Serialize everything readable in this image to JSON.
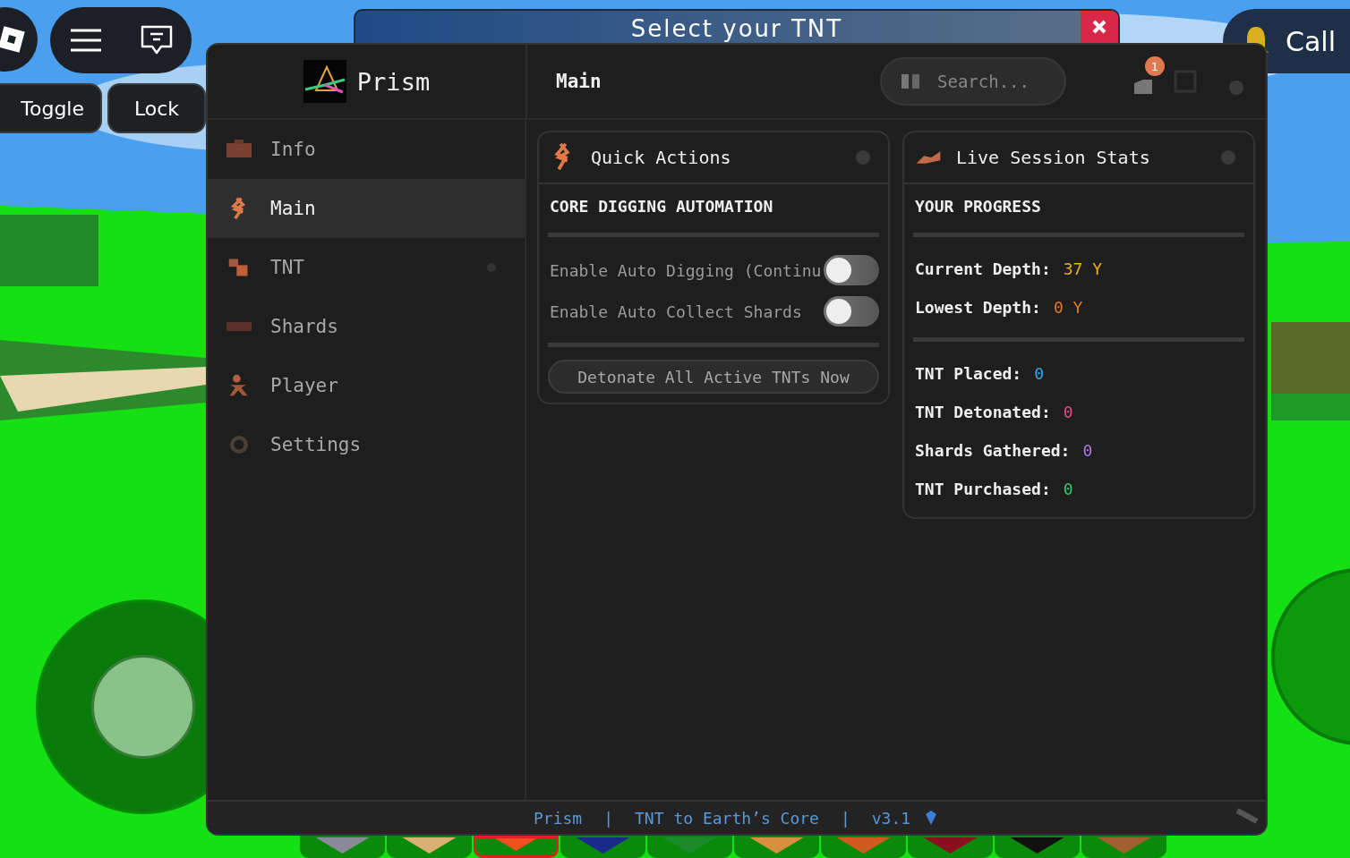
{
  "hud": {
    "toggle_button": "Toggle",
    "lock_button": "Lock",
    "banner_title": "Select your TNT",
    "call_button": "Call"
  },
  "hotbar": [
    {
      "color": "#8a8a9a",
      "selected": false
    },
    {
      "color": "#d8b070",
      "selected": false
    },
    {
      "color": "#f05020",
      "selected": true
    },
    {
      "color": "#1a2a8a",
      "selected": false
    },
    {
      "color": "#1a8a2a",
      "selected": false
    },
    {
      "color": "#d89040",
      "selected": false
    },
    {
      "color": "#d05a20",
      "selected": false
    },
    {
      "color": "#8a1020",
      "selected": false
    },
    {
      "color": "#101010",
      "selected": false
    },
    {
      "color": "#a06030",
      "selected": false
    }
  ],
  "window": {
    "app_name": "Prism",
    "page_title": "Main",
    "search": {
      "placeholder": "Search..."
    },
    "notification_count": "1"
  },
  "sidebar": {
    "items": [
      {
        "label": "Info",
        "selected": false,
        "dot": false
      },
      {
        "label": "Main",
        "selected": true,
        "dot": false
      },
      {
        "label": "TNT",
        "selected": false,
        "dot": true
      },
      {
        "label": "Shards",
        "selected": false,
        "dot": false
      },
      {
        "label": "Player",
        "selected": false,
        "dot": false
      },
      {
        "label": "Settings",
        "selected": false,
        "dot": false
      }
    ]
  },
  "quick_actions": {
    "title": "Quick Actions",
    "section": "CORE DIGGING AUTOMATION",
    "toggles": [
      {
        "label": "Enable Auto Digging (Continu",
        "on": false
      },
      {
        "label": "Enable Auto Collect Shards",
        "on": false
      }
    ],
    "button": "Detonate All Active TNTs Now"
  },
  "session_stats": {
    "title": "Live Session Stats",
    "section": "YOUR PROGRESS",
    "groups": [
      [
        {
          "label": "Current Depth:",
          "value": "37 Y",
          "color": "#e8b020"
        },
        {
          "label": "Lowest Depth:",
          "value": "0 Y",
          "color": "#e87820"
        }
      ],
      [
        {
          "label": "TNT Placed:",
          "value": "0",
          "color": "#30a8e8"
        },
        {
          "label": "TNT Detonated:",
          "value": "0",
          "color": "#e84888"
        },
        {
          "label": "Shards Gathered:",
          "value": "0",
          "color": "#a878e8"
        },
        {
          "label": "TNT Purchased:",
          "value": "0",
          "color": "#38c868"
        }
      ]
    ]
  },
  "footer": {
    "parts": [
      "Prism",
      "|",
      "TNT to Earth’s Core",
      "|",
      "v3.1"
    ]
  }
}
